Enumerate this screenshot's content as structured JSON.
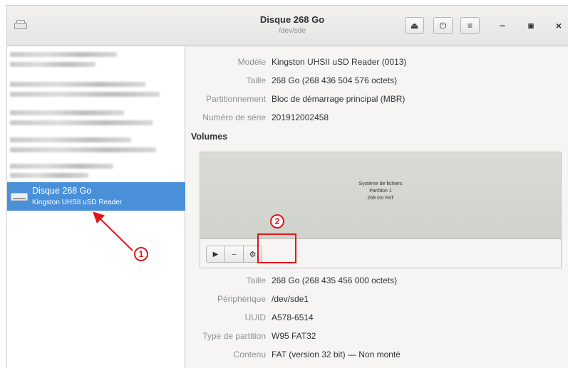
{
  "window": {
    "title": "Disque 268 Go",
    "subtitle": "/dev/sde",
    "app_icon": "disk-utility-icon",
    "header_buttons": [
      {
        "name": "eject",
        "icon": "eject-icon",
        "glyph": "⏏"
      },
      {
        "name": "power",
        "icon": "power-icon",
        "glyph": "⏻"
      },
      {
        "name": "menu",
        "icon": "hamburger-menu-icon",
        "glyph": "≡"
      }
    ],
    "controls": {
      "minimize": "‒",
      "maximize": "▣",
      "close": "×"
    }
  },
  "sidebar": {
    "selected_disk": {
      "name": "Disque 268 Go",
      "model": "Kingston UHSII uSD Reader"
    }
  },
  "drive_info": {
    "rows": [
      {
        "label": "Modèle",
        "value": "Kingston UHSII uSD Reader (0013)"
      },
      {
        "label": "Taille",
        "value": "268 Go (268 436 504 576 octets)"
      },
      {
        "label": "Partitionnement",
        "value": "Bloc de démarrage principal (MBR)"
      },
      {
        "label": "Numéro de série",
        "value": "201912002458"
      }
    ]
  },
  "volumes": {
    "title": "Volumes",
    "partition": {
      "line1": "Système de fichiers",
      "line2": "Partition 1",
      "line3": "268 Go FAT"
    },
    "toolbar": {
      "play": "▶",
      "minus": "–",
      "gears": "⚙"
    }
  },
  "volume_info": {
    "rows": [
      {
        "label": "Taille",
        "value": "268 Go (268 435 456 000 octets)"
      },
      {
        "label": "Périphérique",
        "value": "/dev/sde1"
      },
      {
        "label": "UUID",
        "value": "A578-6514"
      },
      {
        "label": "Type de partition",
        "value": "W95 FAT32"
      },
      {
        "label": "Contenu",
        "value": "FAT (version 32 bit) — Non monté"
      }
    ]
  },
  "annotations": {
    "one": "1",
    "two": "2",
    "color": "#e0161b"
  },
  "colors": {
    "selection": "#4a90d9",
    "window_bg": "#f6f5f4",
    "label_gray": "#8e9192"
  }
}
